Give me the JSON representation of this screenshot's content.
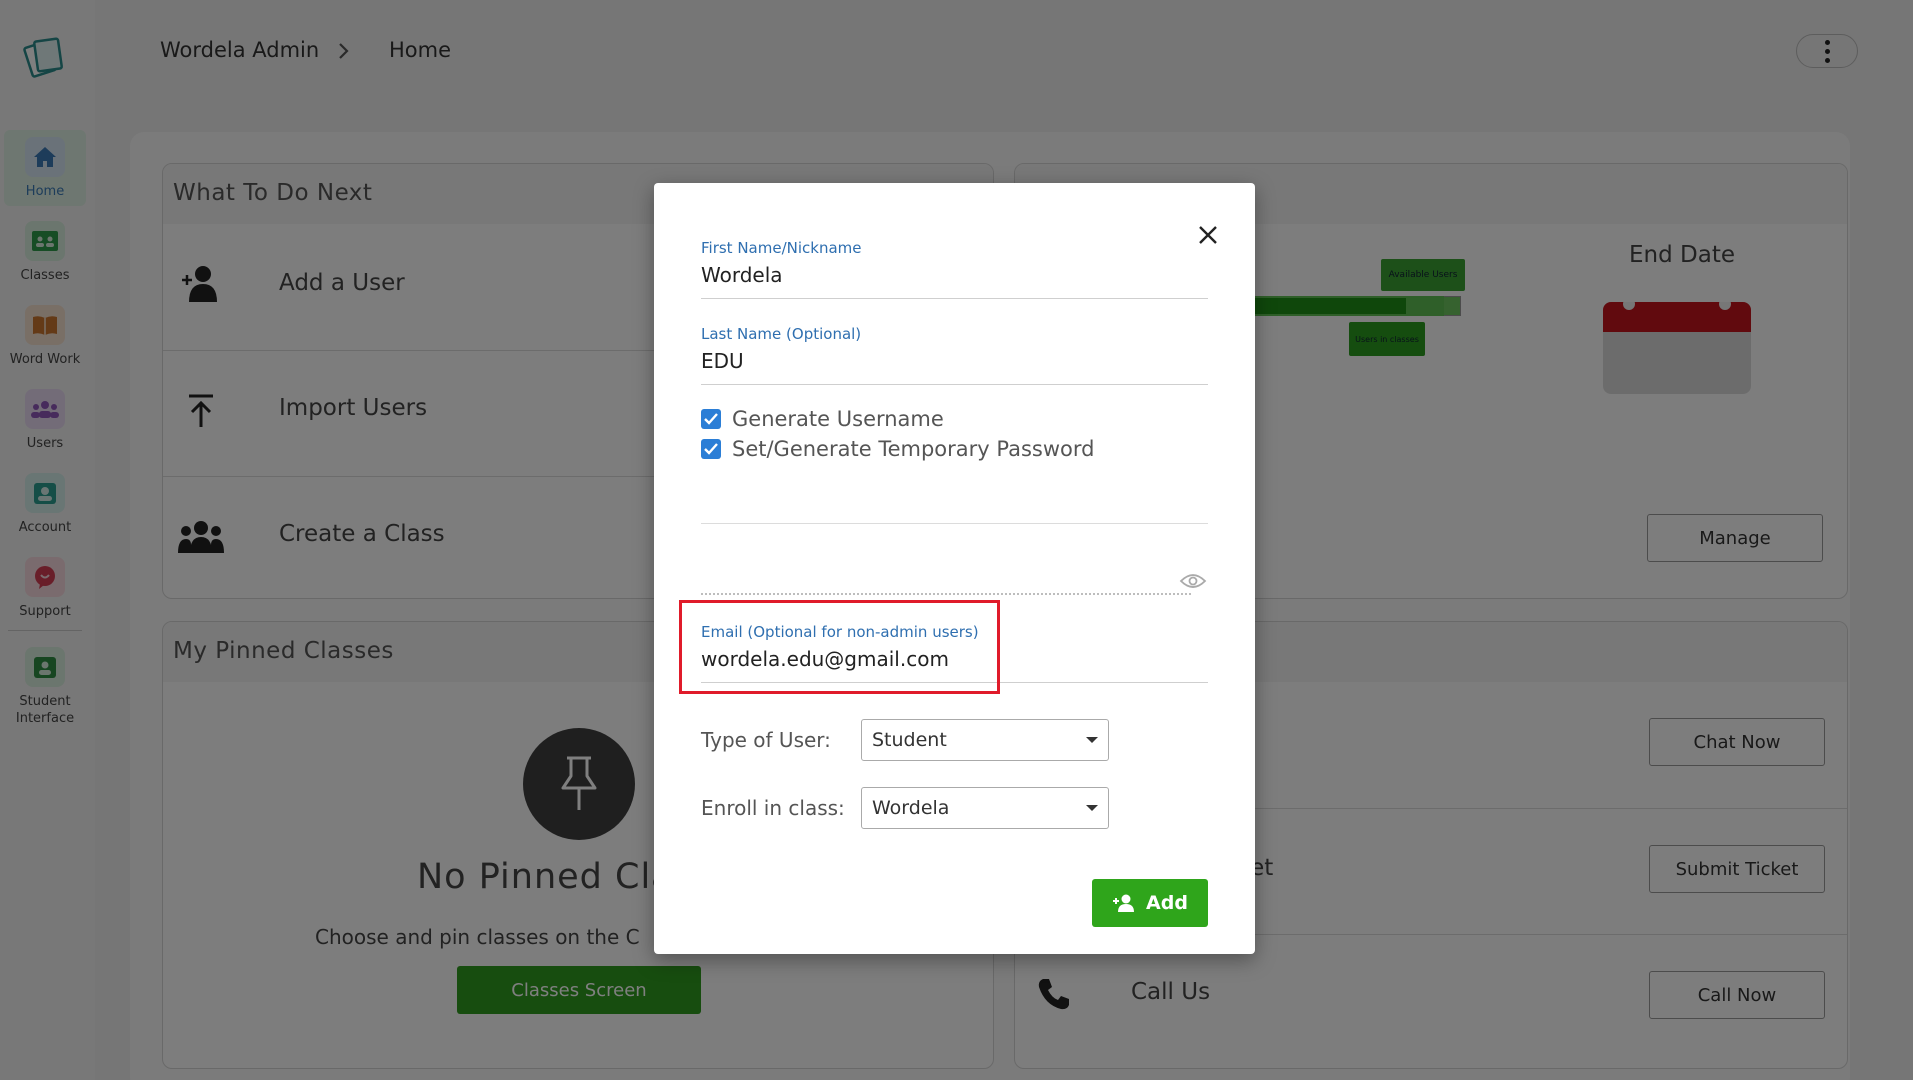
{
  "breadcrumb": {
    "root": "Wordela Admin",
    "current": "Home"
  },
  "sidebar": {
    "items": [
      {
        "label": "Home",
        "icon": "home-icon",
        "color": "#3a78b5"
      },
      {
        "label": "Classes",
        "icon": "classroom-icon",
        "color": "#2e9a4a"
      },
      {
        "label": "Word Work",
        "icon": "book-icon",
        "color": "#c9742f"
      },
      {
        "label": "Users",
        "icon": "users-icon",
        "color": "#8e57b8"
      },
      {
        "label": "Account",
        "icon": "account-icon",
        "color": "#2b9c8e"
      },
      {
        "label": "Support",
        "icon": "support-icon",
        "color": "#d23c52"
      },
      {
        "label": "Student Interface",
        "icon": "student-icon",
        "color": "#2e8c43"
      }
    ]
  },
  "what_to_do": {
    "title": "What To Do Next",
    "items": [
      {
        "label": "Add a User"
      },
      {
        "label": "Import Users"
      },
      {
        "label": "Create a Class"
      }
    ]
  },
  "stats_card": {
    "end_date_label": "End Date",
    "available_users_label": "Available Users",
    "users_in_classes_label": "Users in classes",
    "available_users_fill": 0.95,
    "users_in_classes_fill": 0.84,
    "manage_button": "Manage"
  },
  "pinned": {
    "title": "My Pinned Classes",
    "empty_title": "No Pinned Cla",
    "empty_text": "Choose and pin classes on the C",
    "button": "Classes Screen"
  },
  "support": {
    "chat_button": "Chat Now",
    "ticket_label": "cket",
    "ticket_button": "Submit Ticket",
    "call_label": "Call Us",
    "call_button": "Call Now"
  },
  "modal": {
    "first_name_label": "First Name/Nickname",
    "first_name_value": "Wordela",
    "last_name_label": "Last Name (Optional)",
    "last_name_value": "EDU",
    "generate_username_label": "Generate Username",
    "generate_username_checked": true,
    "temp_password_label": "Set/Generate Temporary Password",
    "temp_password_checked": true,
    "email_label": "Email (Optional for non-admin users)",
    "email_value": "wordela.edu@gmail.com",
    "user_type_label": "Type of User:",
    "user_type_value": "Student",
    "enroll_label": "Enroll in class:",
    "enroll_value": "Wordela",
    "add_button": "Add"
  },
  "colors": {
    "accent_green": "#2fa51b",
    "link_blue": "#2f6fb0",
    "highlight_red": "#e01b2a"
  }
}
